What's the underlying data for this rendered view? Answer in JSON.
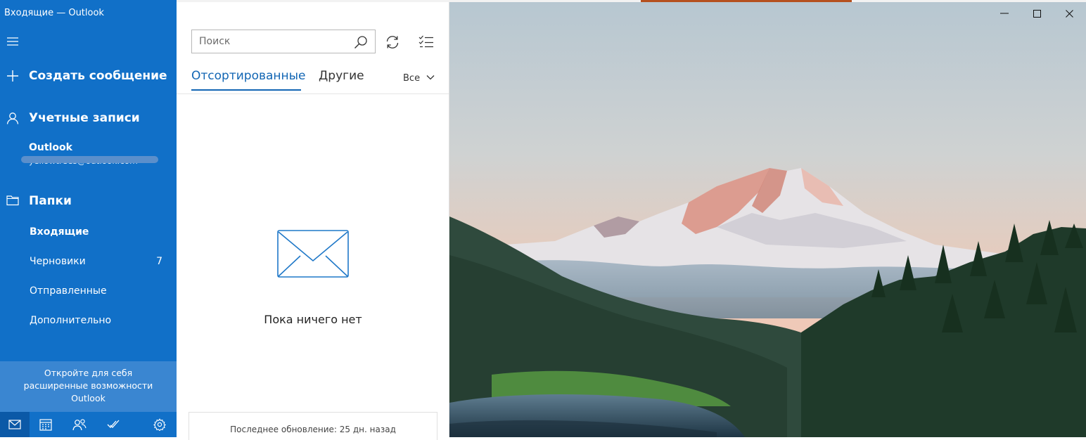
{
  "window": {
    "title": "Входящие — Outlook"
  },
  "nav": {
    "compose_label": "Создать сообщение",
    "accounts_label": "Учетные записи",
    "account": {
      "name": "Outlook",
      "email": "yellowtrees@outlook.com"
    },
    "folders_label": "Папки",
    "folders": [
      {
        "label": "Входящие",
        "count": ""
      },
      {
        "label": "Черновики",
        "count": "7"
      },
      {
        "label": "Отправленные",
        "count": ""
      },
      {
        "label": "Дополнительно",
        "count": ""
      }
    ],
    "promo_lines": [
      "Откройте для себя",
      "расширенные возможности",
      "Outlook"
    ],
    "bottom_icons": [
      "mail-icon",
      "calendar-icon",
      "people-icon",
      "todo-icon",
      "settings-icon"
    ]
  },
  "list": {
    "search_placeholder": "Поиск",
    "tabs": [
      "Отсортированные",
      "Другие"
    ],
    "filter_label": "Все",
    "empty_text": "Пока ничего нет",
    "status_text": "Последнее обновление: 25 дн. назад"
  },
  "colors": {
    "nav_background": "#1170c8",
    "accent": "#1266b4",
    "promo_background": "#3a86d1"
  }
}
